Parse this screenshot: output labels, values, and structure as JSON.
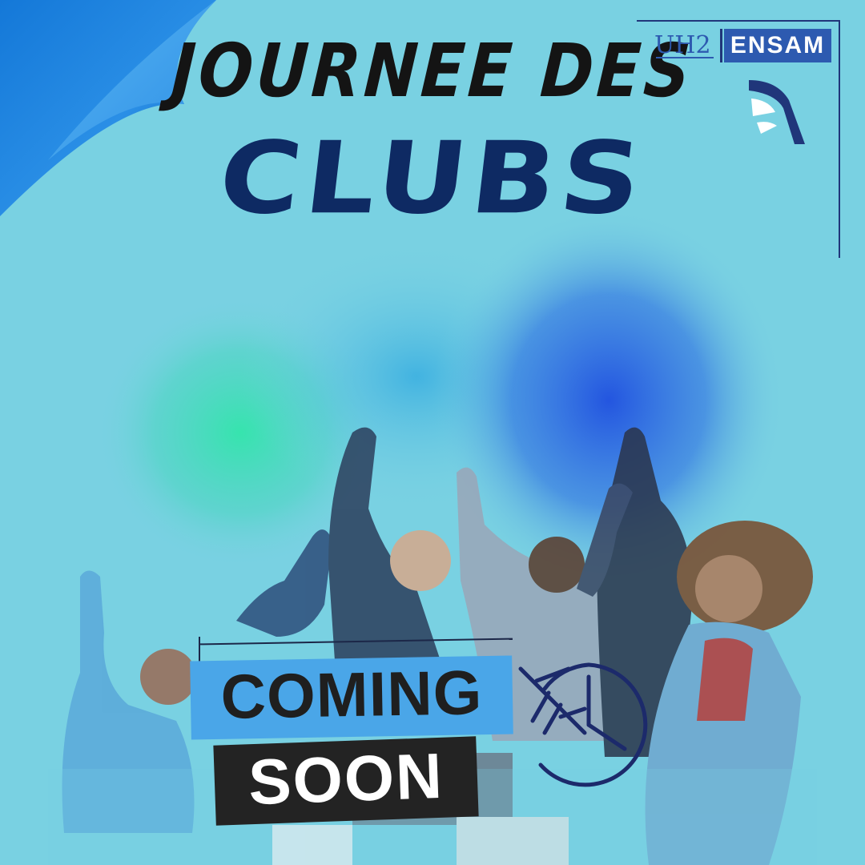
{
  "title": {
    "line1": "JOURNEE DES",
    "line2": "CLUBS"
  },
  "logo": {
    "institution": "ENSAM",
    "university_mark": "UH2"
  },
  "badge": {
    "line1": "COMING",
    "line2": "SOON"
  },
  "icons": {
    "clock": "clock-with-plane-icon",
    "corner": "page-curl"
  },
  "colors": {
    "background": "#79d1e2",
    "title_dark": "#141414",
    "title_navy": "#0e2a63",
    "coming_bg": "#4aa6e8",
    "soon_bg": "#232323",
    "ensam_bg": "#2d5ab0"
  }
}
